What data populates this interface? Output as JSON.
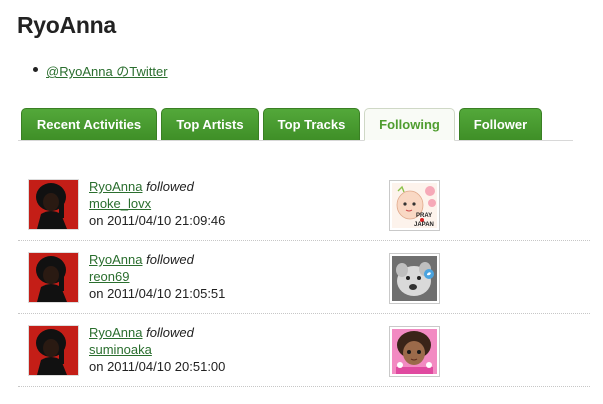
{
  "page": {
    "title": "RyoAnna"
  },
  "links": [
    {
      "label": "@RyoAnna のTwitter"
    }
  ],
  "tabs": [
    {
      "label": "Recent Activities"
    },
    {
      "label": "Top Artists"
    },
    {
      "label": "Top Tracks"
    },
    {
      "label": "Following",
      "active": true
    },
    {
      "label": "Follower"
    }
  ],
  "feed": [
    {
      "user": "RyoAnna",
      "action": "followed",
      "target": "moke_lovx",
      "time": "on 2011/04/10 21:09:46",
      "thumb_icon": "pray-for-japan-avatar-icon"
    },
    {
      "user": "RyoAnna",
      "action": "followed",
      "target": "reon69",
      "time": "on 2011/04/10 21:05:51",
      "thumb_icon": "plush-dog-avatar-icon"
    },
    {
      "user": "RyoAnna",
      "action": "followed",
      "target": "suminoaka",
      "time": "on 2011/04/10 20:51:00",
      "thumb_icon": "cartoon-girl-avatar-icon"
    }
  ],
  "thumb_text": {
    "pray": "PRAY",
    "japan": "JAPAN"
  },
  "colors": {
    "tab_green": "#4a9e32",
    "link_green": "#2a6e2e",
    "avatar_red": "#c41e17"
  }
}
